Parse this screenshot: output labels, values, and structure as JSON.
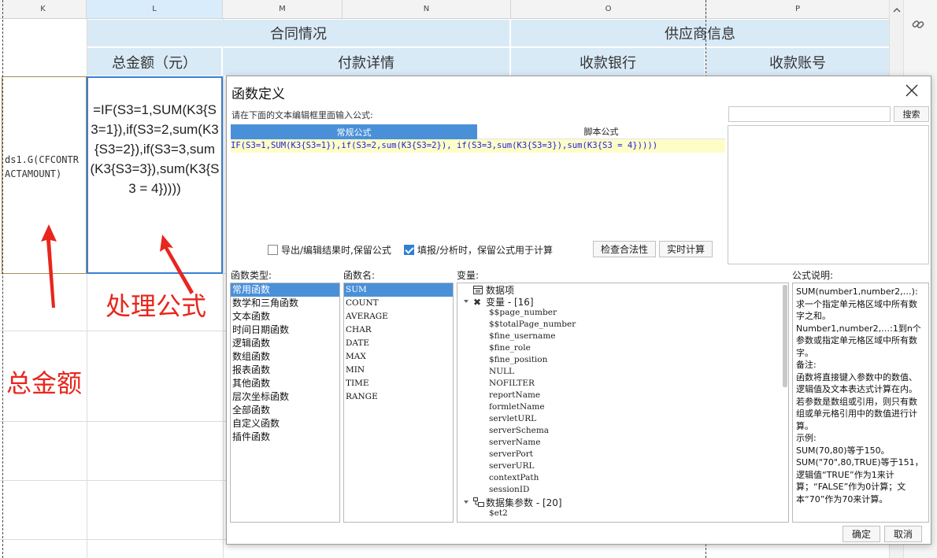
{
  "sheet": {
    "columns": [
      "K",
      "L",
      "M",
      "N",
      "O",
      "P"
    ],
    "header_group_contract": "合同情况",
    "header_group_supplier": "供应商信息",
    "header_total": "总金额（元）",
    "header_payment": "付款详情",
    "header_bank": "收款银行",
    "header_account": "收款账号",
    "cell_k": "ds1.G(CFCONTRACTAMOUNT)",
    "cell_l": "=IF(S3=1,SUM(K3{S3=1}),if(S3=2,sum(K3{S3=2}),if(S3=3,sum(K3{S3=3}),sum(K3{S3 = 4}))))"
  },
  "annotations": {
    "process_formula": "处理公式",
    "total_amount": "总金额",
    "color": "#e8261d"
  },
  "dialog": {
    "title": "函数定义",
    "prompt": "请在下面的文本编辑框里面输入公式:",
    "search_placeholder": "",
    "search_button": "搜索",
    "tab_normal": "常规公式",
    "tab_script": "脚本公式",
    "formula": "IF(S3=1,SUM(K3{S3=1}),if(S3=2,sum(K3{S3=2}), if(S3=3,sum(K3{S3=3}),sum(K3{S3 = 4}))))",
    "check_export_label": "导出/编辑结果时,保留公式",
    "check_export_value": false,
    "check_fill_label": "填报/分析时，保留公式用于计算",
    "check_fill_value": true,
    "btn_check": "检查合法性",
    "btn_realtime": "实时计算",
    "label_func_type": "函数类型:",
    "label_func_name": "函数名:",
    "label_variables": "变量:",
    "label_desc": "公式说明:",
    "func_types": [
      "常用函数",
      "数学和三角函数",
      "文本函数",
      "时间日期函数",
      "逻辑函数",
      "数组函数",
      "报表函数",
      "其他函数",
      "层次坐标函数",
      "全部函数",
      "自定义函数",
      "插件函数"
    ],
    "func_names": [
      "SUM",
      "COUNT",
      "AVERAGE",
      "CHAR",
      "DATE",
      "MAX",
      "MIN",
      "TIME",
      "RANGE"
    ],
    "variables": {
      "data_items": "数据项",
      "var_group": "变量 - [16]",
      "vars": [
        "$$page_number",
        "$$totalPage_number",
        "$fine_username",
        "$fine_role",
        "$fine_position",
        "NULL",
        "NOFILTER",
        "reportName",
        "formletName",
        "servletURL",
        "serverSchema",
        "serverName",
        "serverPort",
        "serverURL",
        "contextPath",
        "sessionID"
      ],
      "dataset_group": "数据集参数 - [20]",
      "dataset_vars": [
        "$et2"
      ]
    },
    "description": [
      "SUM(number1,number2,…):求一个指定单元格区域中所有数字之和。",
      "Number1,number2,…:1到n个参数或指定单元格区域中所有数字。",
      "备注:",
      "函数将直接键入参数中的数值、逻辑值及文本表达式计算在内。若参数是数组或引用，则只有数组或单元格引用中的数值进行计算。",
      "示例:",
      "SUM(70,80)等于150。",
      "SUM(\"70\",80,TRUE)等于151，逻辑值“TRUE”作为1来计算；“FALSE”作为0计算；文本“70”作为70来计算。"
    ],
    "btn_ok": "确定",
    "btn_cancel": "取消"
  }
}
